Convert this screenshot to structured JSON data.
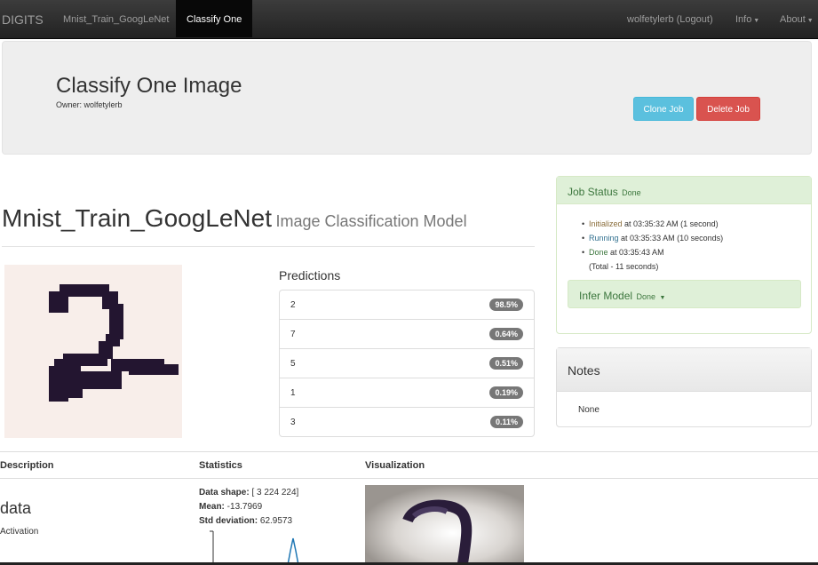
{
  "navbar": {
    "brand": "DIGITS",
    "breadcrumb_model": "Mnist_Train_GoogLeNet",
    "breadcrumb_active": "Classify One",
    "user": "wolfetylerb (Logout)",
    "info": "Info",
    "about": "About"
  },
  "jumbotron": {
    "title": "Classify One Image",
    "owner": "Owner: wolfetylerb",
    "clone_label": "Clone Job",
    "delete_label": "Delete Job"
  },
  "model": {
    "name": "Mnist_Train_GoogLeNet",
    "type": "Image Classification Model"
  },
  "predictions": {
    "title": "Predictions",
    "items": [
      {
        "label": "2",
        "prob": "98.5%"
      },
      {
        "label": "7",
        "prob": "0.64%"
      },
      {
        "label": "5",
        "prob": "0.51%"
      },
      {
        "label": "1",
        "prob": "0.19%"
      },
      {
        "label": "3",
        "prob": "0.11%"
      }
    ]
  },
  "job_status": {
    "title": "Job Status",
    "state": "Done",
    "steps": [
      {
        "name": "Initialized",
        "rest": " at 03:35:32 AM (1 second)"
      },
      {
        "name": "Running",
        "rest": " at 03:35:33 AM (10 seconds)"
      },
      {
        "name": "Done",
        "rest": " at 03:35:43 AM"
      }
    ],
    "total": "(Total - 11 seconds)",
    "infer_title": "Infer Model",
    "infer_state": "Done"
  },
  "notes": {
    "title": "Notes",
    "body": "None"
  },
  "table": {
    "col_description": "Description",
    "col_statistics": "Statistics",
    "col_visualization": "Visualization",
    "layer_name": "data",
    "layer_type": "Activation",
    "stats_shape_label": "Data shape:",
    "stats_shape_value": " [ 3 224 224]",
    "stats_mean_label": "Mean:",
    "stats_mean_value": " -13.7969",
    "stats_std_label": "Std deviation:",
    "stats_std_value": " 62.9573"
  },
  "colors": {
    "navbar": "#222222",
    "success": "#3c763d",
    "info_button": "#5bc0de",
    "danger_button": "#d9534f",
    "digit": "#231530"
  }
}
